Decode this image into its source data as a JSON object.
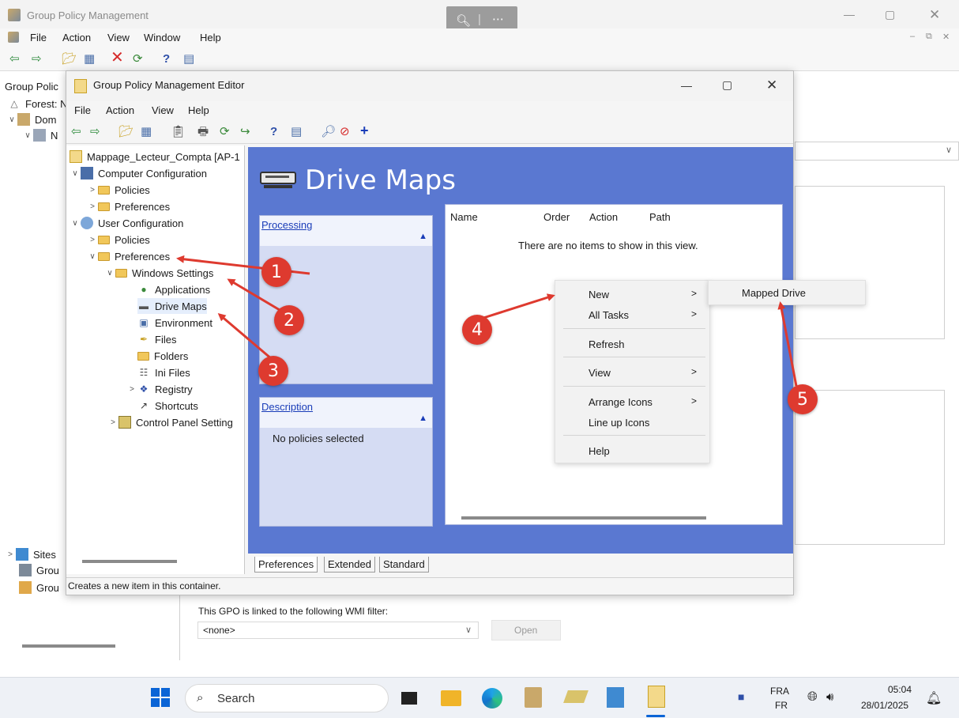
{
  "outer_window": {
    "title": "Group Policy Management",
    "menu": [
      "File",
      "Action",
      "View",
      "Window",
      "Help"
    ],
    "tree": [
      {
        "label": "Group Polic"
      },
      {
        "label": "Forest: N"
      },
      {
        "label": "Dom"
      },
      {
        "label": "N"
      },
      {
        "label": "Sites"
      },
      {
        "label": "Grou"
      },
      {
        "label": "Grou"
      }
    ]
  },
  "gpme": {
    "title": "Group Policy Management Editor",
    "menu": [
      "File",
      "Action",
      "View",
      "Help"
    ],
    "tree": {
      "root": "Mappage_Lecteur_Compta [AP-1",
      "computer_configuration": "Computer Configuration",
      "cc_policies": "Policies",
      "cc_preferences": "Preferences",
      "user_configuration": "User Configuration",
      "uc_policies": "Policies",
      "uc_preferences": "Preferences",
      "windows_settings": "Windows Settings",
      "applications": "Applications",
      "drive_maps": "Drive Maps",
      "environment": "Environment",
      "files": "Files",
      "folders": "Folders",
      "ini_files": "Ini Files",
      "registry": "Registry",
      "shortcuts": "Shortcuts",
      "control_panel_settings": "Control Panel Setting"
    },
    "pane": {
      "title": "Drive Maps",
      "processing_label": "Processing",
      "description_label": "Description",
      "description_text": "No policies selected",
      "columns": [
        "Name",
        "Order",
        "Action",
        "Path"
      ],
      "empty_text": "There are no items to show in this view."
    },
    "tabs": [
      "Preferences",
      "Extended",
      "Standard"
    ],
    "status": "Creates a new item in this container."
  },
  "context_menu": {
    "items": [
      {
        "label": "New",
        "submenu": true
      },
      {
        "label": "All Tasks",
        "submenu": true
      },
      {
        "label": "Refresh",
        "submenu": false
      },
      {
        "label": "View",
        "submenu": true
      },
      {
        "label": "Arrange Icons",
        "submenu": true
      },
      {
        "label": "Line up Icons",
        "submenu": false
      },
      {
        "label": "Help",
        "submenu": false
      }
    ],
    "submenu_item": "Mapped Drive"
  },
  "annotations": {
    "badges": [
      "1",
      "2",
      "3",
      "4",
      "5"
    ],
    "color": "#de3a2f"
  },
  "wmi": {
    "label": "This GPO is linked to the following WMI filter:",
    "value": "<none>",
    "open_label": "Open"
  },
  "taskbar": {
    "search_label": "Search",
    "lang_top": "FRA",
    "lang_bottom": "FR",
    "time": "05:04",
    "date": "28/01/2025"
  },
  "colors": {
    "pane_blue": "#5a78d1",
    "link_blue": "#1a3db8"
  }
}
